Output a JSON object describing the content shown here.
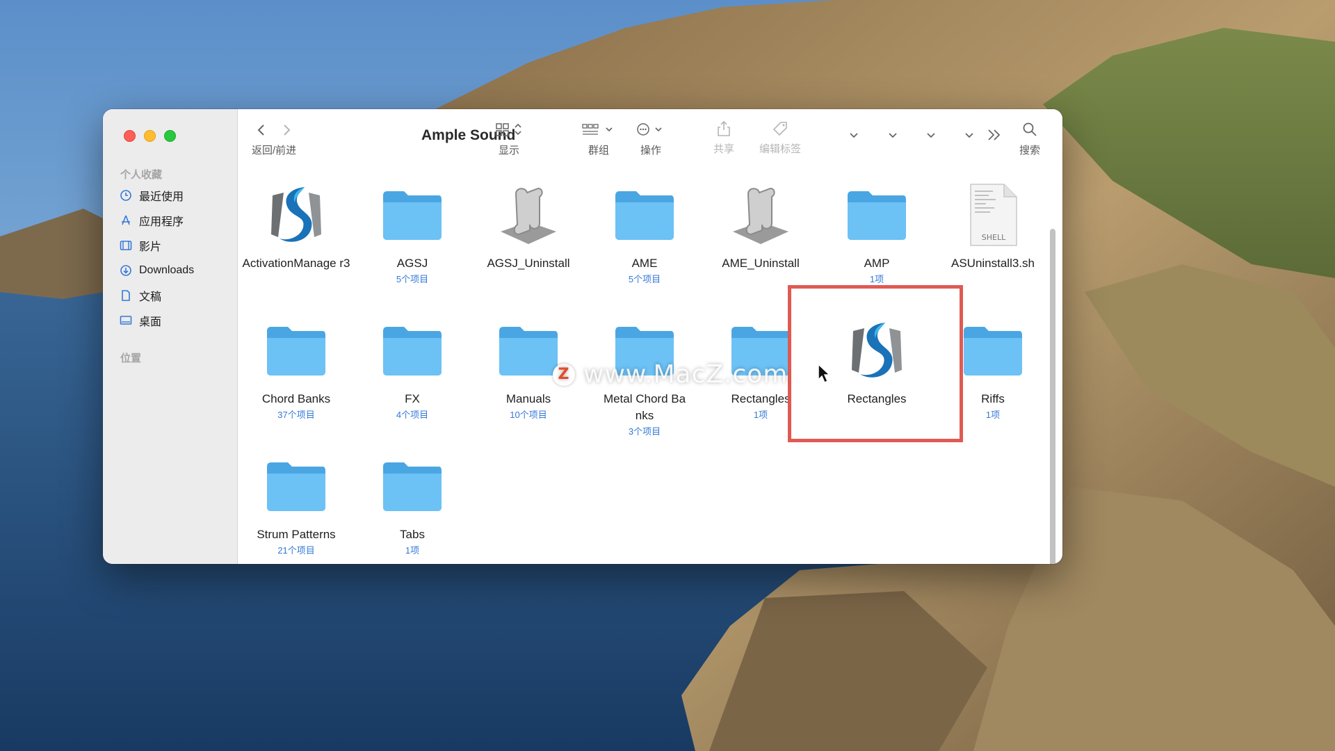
{
  "window": {
    "title": "Ample Sound"
  },
  "sidebar": {
    "favorites_heading": "个人收藏",
    "items": [
      {
        "label": "最近使用",
        "icon": "clock-icon"
      },
      {
        "label": "应用程序",
        "icon": "apps-icon"
      },
      {
        "label": "影片",
        "icon": "film-icon"
      },
      {
        "label": "Downloads",
        "icon": "download-icon"
      },
      {
        "label": "文稿",
        "icon": "document-icon"
      },
      {
        "label": "桌面",
        "icon": "desktop-icon"
      }
    ],
    "locations_heading": "位置"
  },
  "toolbar": {
    "back_forward_label": "返回/前进",
    "view_label": "显示",
    "group_label": "群组",
    "action_label": "操作",
    "share_label": "共享",
    "tags_label": "编辑标签",
    "search_label": "搜索"
  },
  "files": [
    {
      "name": "ActivationManage r3",
      "count": "",
      "kind": "app"
    },
    {
      "name": "AGSJ",
      "count": "5个项目",
      "kind": "folder"
    },
    {
      "name": "AGSJ_Uninstall",
      "count": "",
      "kind": "script"
    },
    {
      "name": "AME",
      "count": "5个项目",
      "kind": "folder"
    },
    {
      "name": "AME_Uninstall",
      "count": "",
      "kind": "script"
    },
    {
      "name": "AMP",
      "count": "1项",
      "kind": "folder"
    },
    {
      "name": "ASUninstall3.sh",
      "count": "",
      "kind": "shell",
      "badge": "SHELL"
    },
    {
      "name": "Chord Banks",
      "count": "37个项目",
      "kind": "folder"
    },
    {
      "name": "FX",
      "count": "4个项目",
      "kind": "folder"
    },
    {
      "name": "Manuals",
      "count": "10个项目",
      "kind": "folder"
    },
    {
      "name": "Metal Chord Banks",
      "count": "3个项目",
      "kind": "folder"
    },
    {
      "name": "Rectangles",
      "count": "1项",
      "kind": "folder"
    },
    {
      "name": "Rectangles",
      "count": "",
      "kind": "app"
    },
    {
      "name": "Riffs",
      "count": "1项",
      "kind": "folder"
    },
    {
      "name": "Strum Patterns",
      "count": "21个项目",
      "kind": "folder"
    },
    {
      "name": "Tabs",
      "count": "1项",
      "kind": "folder"
    }
  ],
  "watermark": {
    "logo": "Z",
    "text": "www.MacZ.com"
  },
  "colors": {
    "highlight": "#e05a53",
    "folder": "#5cb4ef",
    "count_text": "#3478d8"
  }
}
